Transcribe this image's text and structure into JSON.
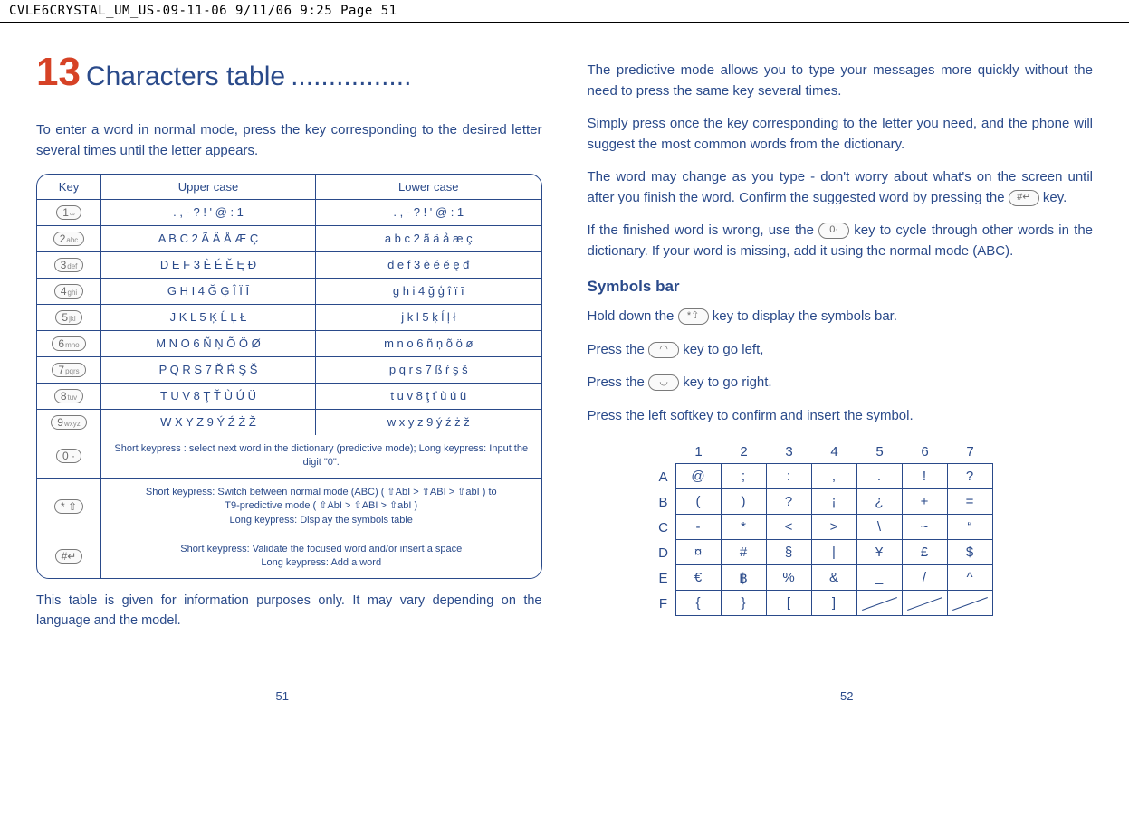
{
  "header_line": "CVLE6CRYSTAL_UM_US-09-11-06  9/11/06  9:25  Page 51",
  "chapter": {
    "num": "13",
    "title": "Characters table",
    "dots": "................"
  },
  "left_intro": "To enter a word in normal mode, press the key corresponding to the desired letter several times until the letter appears.",
  "table": {
    "headers": {
      "key": "Key",
      "upper": "Upper case",
      "lower": "Lower case"
    },
    "rows": [
      {
        "key": "1",
        "ksub": "∞",
        "upper": ". , - ? ! ' @ : 1",
        "lower": ". , - ? ! ' @ : 1"
      },
      {
        "key": "2",
        "ksub": "abc",
        "upper": "A B C 2 Ã Ä Å Æ Ç",
        "lower": "a b c 2 ã ä å æ ç"
      },
      {
        "key": "3",
        "ksub": "def",
        "upper": "D E F 3 È É Ě Ę Đ",
        "lower": "d e f 3 è é ě ę đ"
      },
      {
        "key": "4",
        "ksub": "ghi",
        "upper": "G H I 4 Ğ Ģ Î Ï Ī",
        "lower": "g h i 4 ğ ģ î ï ī"
      },
      {
        "key": "5",
        "ksub": "jkl",
        "upper": "J K L 5 Ķ Ĺ Ļ Ł",
        "lower": "j k l 5 ķ ĺ ļ ł"
      },
      {
        "key": "6",
        "ksub": "mno",
        "upper": "M N O 6 Ñ Ņ Õ Ö Ø",
        "lower": "m n o 6 ñ ņ õ ö ø"
      },
      {
        "key": "7",
        "ksub": "pqrs",
        "upper": "P Q R S 7 Ř Ŕ Ş Š",
        "lower": "p q r s 7 ß ŕ ş š"
      },
      {
        "key": "8",
        "ksub": "tuv",
        "upper": "T U V 8 Ţ Ť Ù Ú Ü",
        "lower": "t u v 8 ţ ť ù ú ü"
      },
      {
        "key": "9",
        "ksub": "wxyz",
        "upper": "W X Y Z 9 Ý Ź Ż Ž",
        "lower": "w x y z 9 ý ź ż ž"
      }
    ],
    "note0_key": "0 ·",
    "note0": "Short keypress : select next word in the dictionary (predictive mode); Long keypress: Input the digit \"0\".",
    "noteStar_key": "* ⇧",
    "noteStar_l1": "Short keypress: Switch between normal mode (ABC) ( ⇧AbI  >  ⇧ABI  >  ⇧abI ) to",
    "noteStar_l2": "T9-predictive mode ( ⇧AbI  >  ⇧ABI  >  ⇧abI )",
    "noteStar_l3": "Long keypress: Display the symbols table",
    "noteHash_key": "#↵",
    "noteHash_l1": "Short keypress: Validate the focused word and/or insert a space",
    "noteHash_l2": "Long keypress: Add a word"
  },
  "table_footer": "This table is given for information purposes only. It may vary depending on the language and the model.",
  "right": {
    "p1": "The predictive mode allows you to type your messages more quickly without the need to press the same key several times.",
    "p2": "Simply press once the key corresponding to the letter you need, and the phone will suggest the most common words from the dictionary.",
    "p3a": "The word may change as you type - don't worry about what's on the screen until after you finish the word. Confirm the suggested word by pressing the ",
    "p3_key": "#↵",
    "p3b": " key.",
    "p4a": "If the finished word is wrong, use the ",
    "p4_key": "0·",
    "p4b": " key to cycle through other words in the dictionary. If your word is missing, add it using the normal mode (ABC).",
    "symbols_heading": "Symbols bar",
    "p5a": "Hold down the ",
    "p5_key": "*⇧",
    "p5b": " key to display the symbols bar.",
    "p6a": "Press the ",
    "p6_key": "◠",
    "p6b": " key to go left,",
    "p7a": "Press the ",
    "p7_key": "◡",
    "p7b": " key to go right.",
    "p8": "Press the left softkey to confirm and insert the symbol."
  },
  "symbols_grid": {
    "cols": [
      "1",
      "2",
      "3",
      "4",
      "5",
      "6",
      "7"
    ],
    "rows": [
      {
        "label": "A",
        "cells": [
          "@",
          ";",
          ":",
          ",",
          ".",
          "!",
          "?"
        ]
      },
      {
        "label": "B",
        "cells": [
          "(",
          ")",
          "?",
          "¡",
          "¿",
          "+",
          "="
        ]
      },
      {
        "label": "C",
        "cells": [
          "-",
          "*",
          "<",
          ">",
          "\\",
          "~",
          "“"
        ]
      },
      {
        "label": "D",
        "cells": [
          "¤",
          "#",
          "§",
          "|",
          "¥",
          "£",
          "$"
        ]
      },
      {
        "label": "E",
        "cells": [
          "€",
          "฿",
          "%",
          "&",
          "_",
          "/",
          "^"
        ]
      },
      {
        "label": "F",
        "cells": [
          "{",
          "}",
          "[",
          "]",
          "/",
          "/",
          "/"
        ],
        "crossed": [
          4,
          5,
          6
        ]
      }
    ]
  },
  "page_nums": {
    "left": "51",
    "right": "52"
  }
}
